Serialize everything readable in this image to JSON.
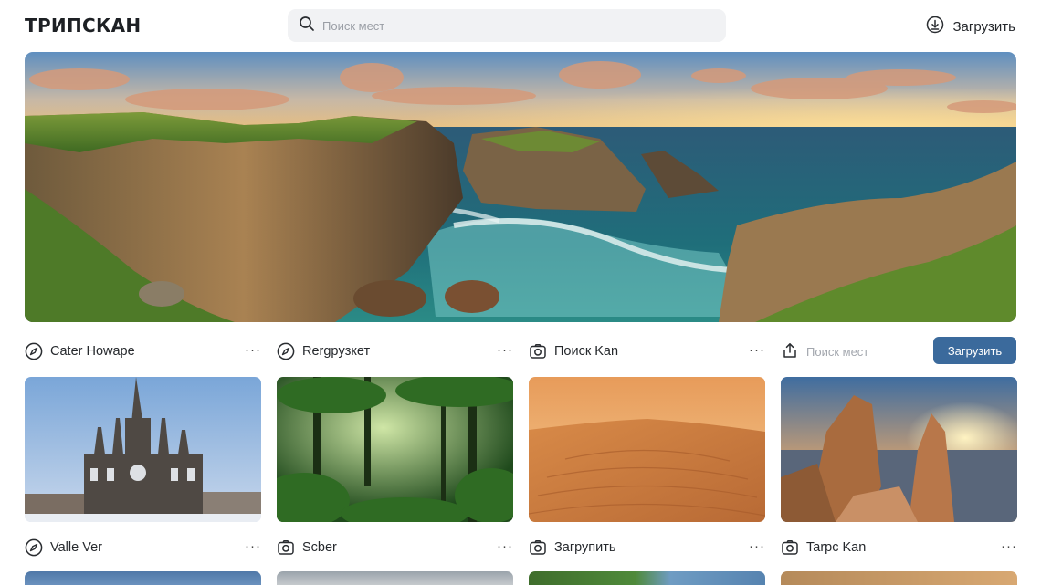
{
  "header": {
    "logo": "ТРИПСКАН",
    "search_placeholder": "Поиск мест",
    "upload_label": "Загрузить"
  },
  "toolbar": {
    "search_placeholder": "Поиск мест",
    "upload_label": "Загрузить"
  },
  "cards_row1": [
    {
      "label": "Cater Howape",
      "icon": "compass-icon"
    },
    {
      "label": "Rergpyзкет",
      "icon": "compass-icon"
    },
    {
      "label": "Поиск Kan",
      "icon": "camera-icon"
    }
  ],
  "cards_row2": [
    {
      "label": "Valle Ver",
      "icon": "compass-icon"
    },
    {
      "label": "Sсber",
      "icon": "camera-icon"
    },
    {
      "label": "Загрупить",
      "icon": "camera-icon"
    },
    {
      "label": "Tarpc Kan",
      "icon": "camera-icon"
    }
  ],
  "more_label": "···",
  "colors": {
    "accent": "#3b6a9c"
  }
}
